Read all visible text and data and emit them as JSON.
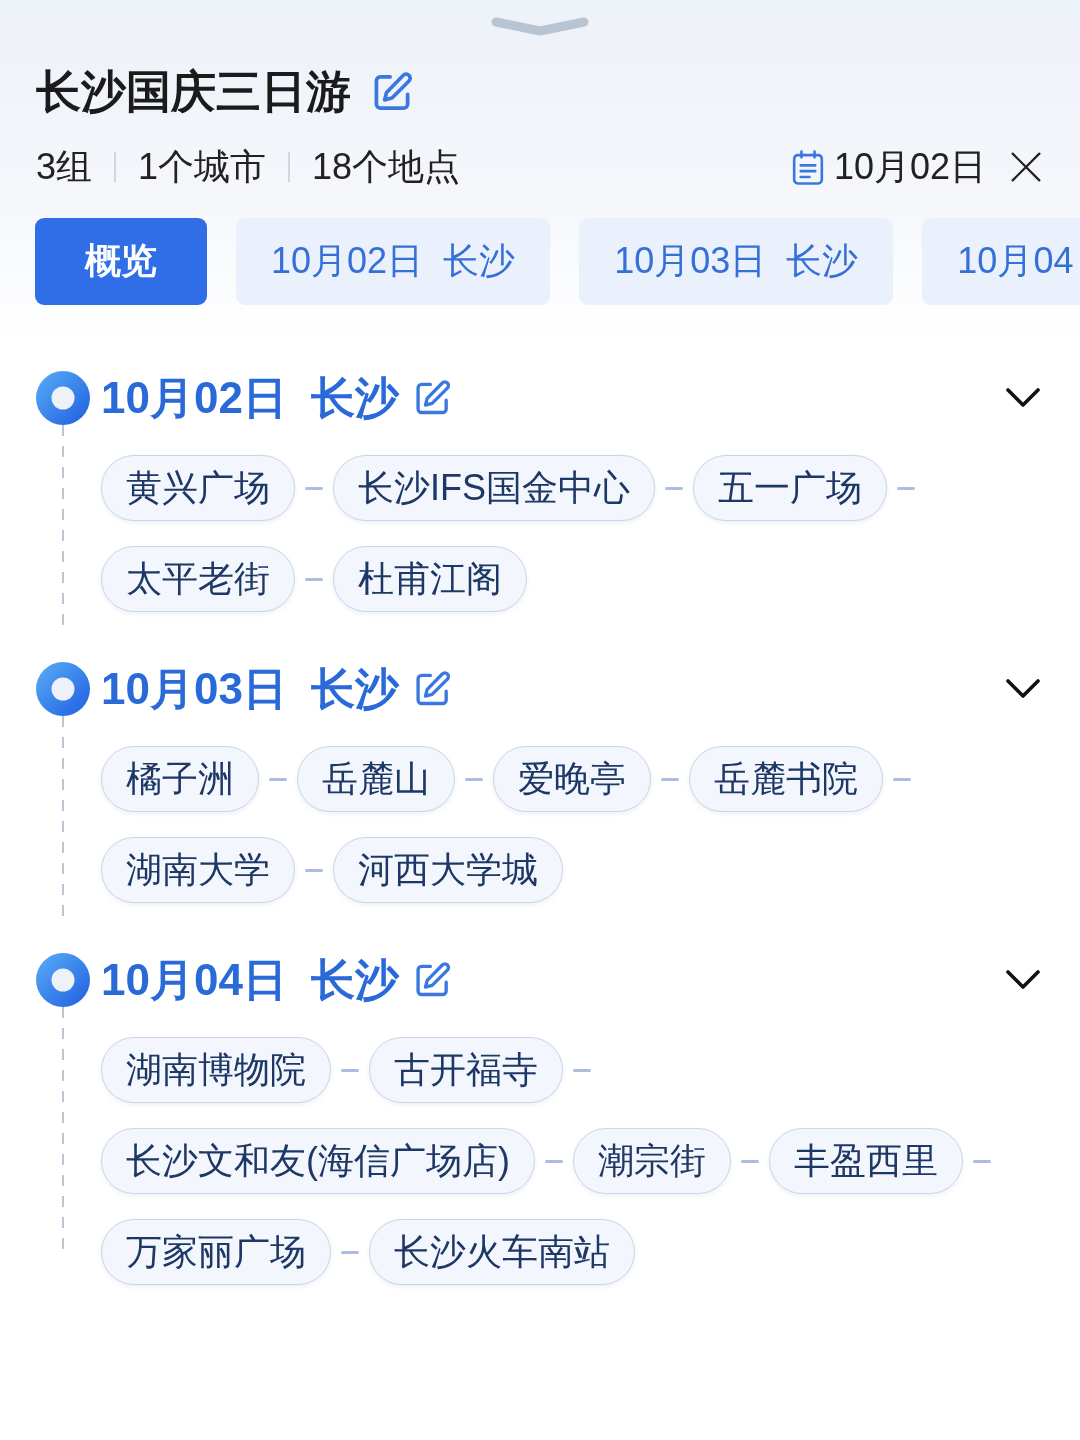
{
  "trip": {
    "title": "长沙国庆三日游",
    "stats": [
      "3组",
      "1个城市",
      "18个地点"
    ],
    "date": "10月02日"
  },
  "tabs": [
    {
      "label": "概览",
      "selected": true
    },
    {
      "label": "10月02日 长沙",
      "selected": false
    },
    {
      "label": "10月03日 长沙",
      "selected": false
    },
    {
      "label": "10月04",
      "selected": false
    }
  ],
  "days": [
    {
      "title": "10月02日 长沙",
      "expanded": true,
      "places": [
        "黄兴广场",
        "长沙IFS国金中心",
        "五一广场",
        "太平老街",
        "杜甫江阁"
      ]
    },
    {
      "title": "10月03日 长沙",
      "expanded": true,
      "places": [
        "橘子洲",
        "岳麓山",
        "爱晚亭",
        "岳麓书院",
        "湖南大学",
        "河西大学城"
      ]
    },
    {
      "title": "10月04日 长沙",
      "expanded": true,
      "places": [
        "湖南博物院",
        "古开福寺",
        "长沙文和友(海信广场店)",
        "潮宗街",
        "丰盈西里",
        "万家丽广场",
        "长沙火车南站"
      ]
    }
  ]
}
